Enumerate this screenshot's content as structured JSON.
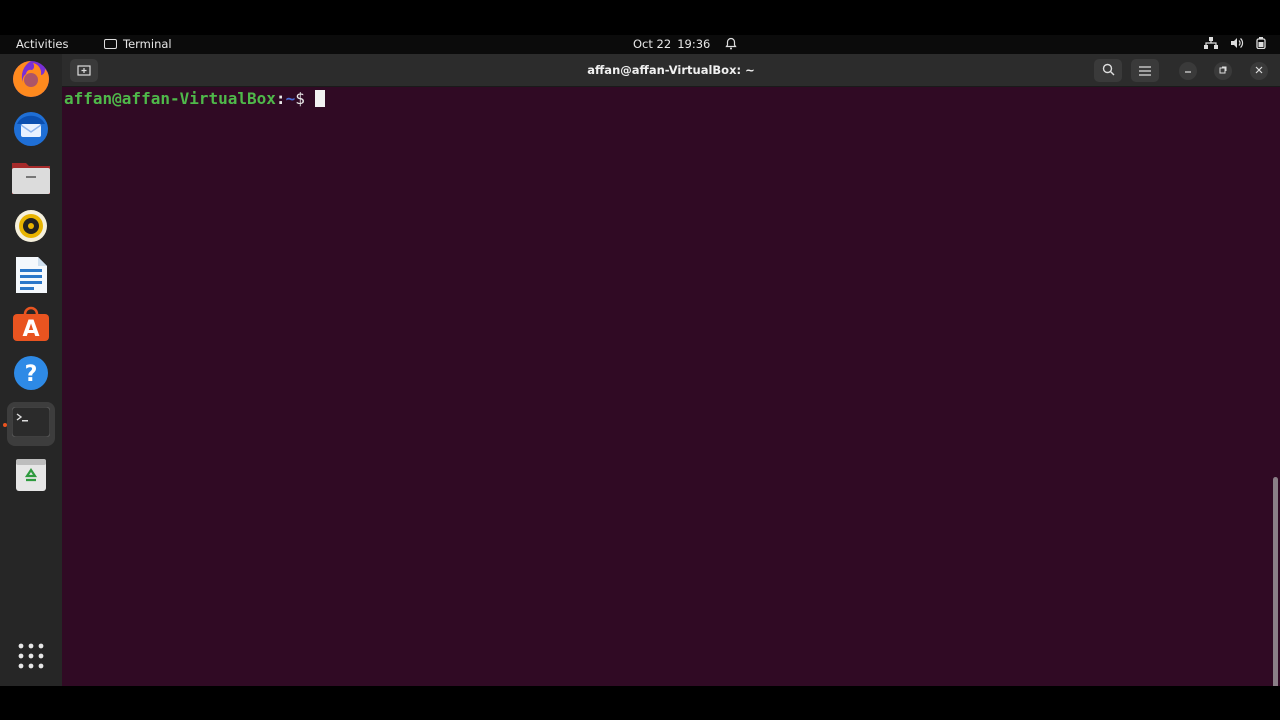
{
  "panel": {
    "activities": "Activities",
    "app_name": "Terminal",
    "date": "Oct 22",
    "time": "19:36"
  },
  "dock": {
    "items": [
      {
        "name": "Firefox",
        "icon": "firefox-icon"
      },
      {
        "name": "Thunderbird",
        "icon": "thunderbird-icon"
      },
      {
        "name": "Files",
        "icon": "files-icon"
      },
      {
        "name": "Rhythmbox",
        "icon": "rhythmbox-icon"
      },
      {
        "name": "LibreOffice Writer",
        "icon": "writer-icon"
      },
      {
        "name": "Ubuntu Software",
        "icon": "software-icon"
      },
      {
        "name": "Help",
        "icon": "help-icon"
      },
      {
        "name": "Terminal",
        "icon": "terminal-icon",
        "active": true
      },
      {
        "name": "Trash",
        "icon": "trash-icon"
      }
    ],
    "show_apps_icon": "grid-icon"
  },
  "window": {
    "title": "affan@affan-VirtualBox: ~"
  },
  "terminal": {
    "user_host": "affan@affan-VirtualBox",
    "colon": ":",
    "path": "~",
    "symbol": "$"
  },
  "colors": {
    "terminal_bg": "#300a24",
    "prompt_user": "#4fb84a",
    "prompt_path": "#4b6ed8",
    "accent": "#e95420"
  }
}
